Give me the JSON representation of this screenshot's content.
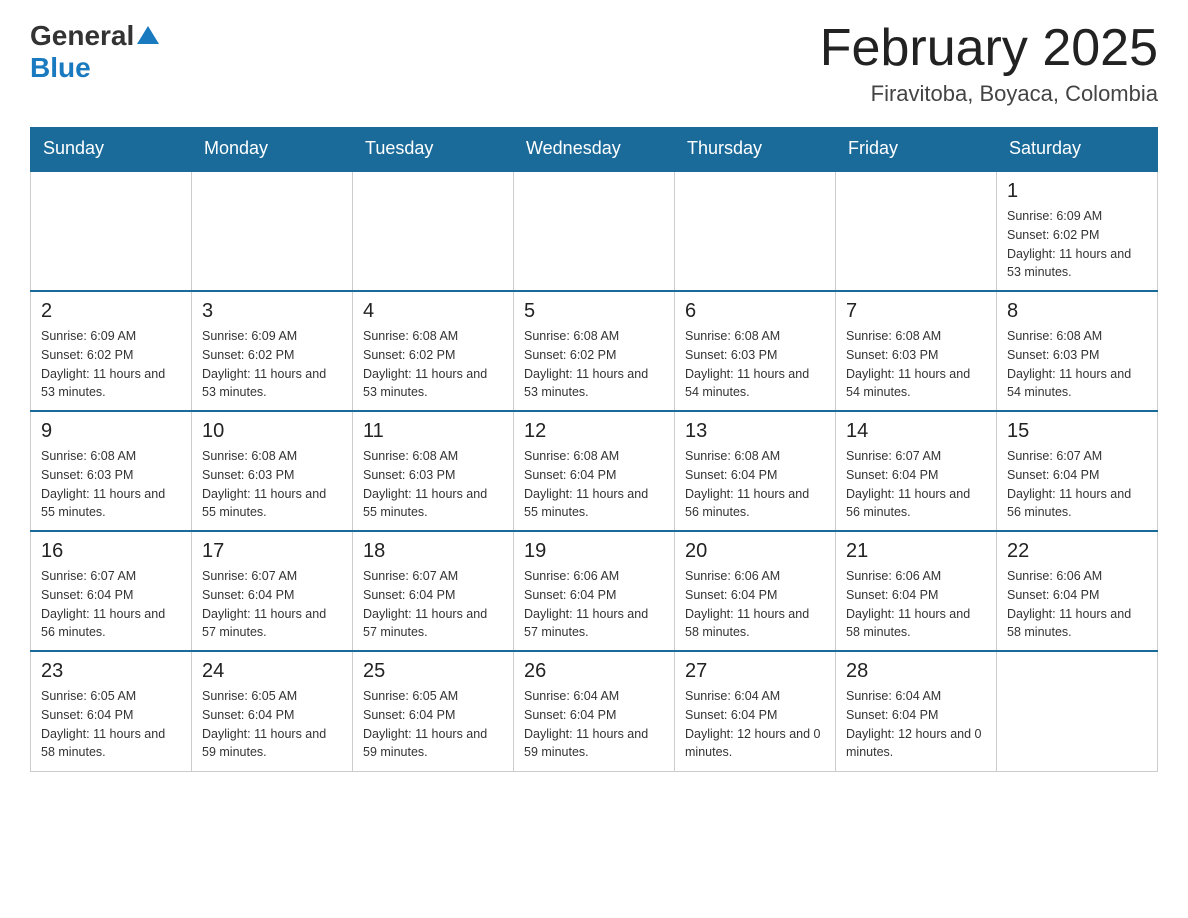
{
  "logo": {
    "general": "General",
    "blue": "Blue"
  },
  "title": "February 2025",
  "subtitle": "Firavitoba, Boyaca, Colombia",
  "days_of_week": [
    "Sunday",
    "Monday",
    "Tuesday",
    "Wednesday",
    "Thursday",
    "Friday",
    "Saturday"
  ],
  "weeks": [
    [
      {
        "day": "",
        "sunrise": "",
        "sunset": "",
        "daylight": ""
      },
      {
        "day": "",
        "sunrise": "",
        "sunset": "",
        "daylight": ""
      },
      {
        "day": "",
        "sunrise": "",
        "sunset": "",
        "daylight": ""
      },
      {
        "day": "",
        "sunrise": "",
        "sunset": "",
        "daylight": ""
      },
      {
        "day": "",
        "sunrise": "",
        "sunset": "",
        "daylight": ""
      },
      {
        "day": "",
        "sunrise": "",
        "sunset": "",
        "daylight": ""
      },
      {
        "day": "1",
        "sunrise": "Sunrise: 6:09 AM",
        "sunset": "Sunset: 6:02 PM",
        "daylight": "Daylight: 11 hours and 53 minutes."
      }
    ],
    [
      {
        "day": "2",
        "sunrise": "Sunrise: 6:09 AM",
        "sunset": "Sunset: 6:02 PM",
        "daylight": "Daylight: 11 hours and 53 minutes."
      },
      {
        "day": "3",
        "sunrise": "Sunrise: 6:09 AM",
        "sunset": "Sunset: 6:02 PM",
        "daylight": "Daylight: 11 hours and 53 minutes."
      },
      {
        "day": "4",
        "sunrise": "Sunrise: 6:08 AM",
        "sunset": "Sunset: 6:02 PM",
        "daylight": "Daylight: 11 hours and 53 minutes."
      },
      {
        "day": "5",
        "sunrise": "Sunrise: 6:08 AM",
        "sunset": "Sunset: 6:02 PM",
        "daylight": "Daylight: 11 hours and 53 minutes."
      },
      {
        "day": "6",
        "sunrise": "Sunrise: 6:08 AM",
        "sunset": "Sunset: 6:03 PM",
        "daylight": "Daylight: 11 hours and 54 minutes."
      },
      {
        "day": "7",
        "sunrise": "Sunrise: 6:08 AM",
        "sunset": "Sunset: 6:03 PM",
        "daylight": "Daylight: 11 hours and 54 minutes."
      },
      {
        "day": "8",
        "sunrise": "Sunrise: 6:08 AM",
        "sunset": "Sunset: 6:03 PM",
        "daylight": "Daylight: 11 hours and 54 minutes."
      }
    ],
    [
      {
        "day": "9",
        "sunrise": "Sunrise: 6:08 AM",
        "sunset": "Sunset: 6:03 PM",
        "daylight": "Daylight: 11 hours and 55 minutes."
      },
      {
        "day": "10",
        "sunrise": "Sunrise: 6:08 AM",
        "sunset": "Sunset: 6:03 PM",
        "daylight": "Daylight: 11 hours and 55 minutes."
      },
      {
        "day": "11",
        "sunrise": "Sunrise: 6:08 AM",
        "sunset": "Sunset: 6:03 PM",
        "daylight": "Daylight: 11 hours and 55 minutes."
      },
      {
        "day": "12",
        "sunrise": "Sunrise: 6:08 AM",
        "sunset": "Sunset: 6:04 PM",
        "daylight": "Daylight: 11 hours and 55 minutes."
      },
      {
        "day": "13",
        "sunrise": "Sunrise: 6:08 AM",
        "sunset": "Sunset: 6:04 PM",
        "daylight": "Daylight: 11 hours and 56 minutes."
      },
      {
        "day": "14",
        "sunrise": "Sunrise: 6:07 AM",
        "sunset": "Sunset: 6:04 PM",
        "daylight": "Daylight: 11 hours and 56 minutes."
      },
      {
        "day": "15",
        "sunrise": "Sunrise: 6:07 AM",
        "sunset": "Sunset: 6:04 PM",
        "daylight": "Daylight: 11 hours and 56 minutes."
      }
    ],
    [
      {
        "day": "16",
        "sunrise": "Sunrise: 6:07 AM",
        "sunset": "Sunset: 6:04 PM",
        "daylight": "Daylight: 11 hours and 56 minutes."
      },
      {
        "day": "17",
        "sunrise": "Sunrise: 6:07 AM",
        "sunset": "Sunset: 6:04 PM",
        "daylight": "Daylight: 11 hours and 57 minutes."
      },
      {
        "day": "18",
        "sunrise": "Sunrise: 6:07 AM",
        "sunset": "Sunset: 6:04 PM",
        "daylight": "Daylight: 11 hours and 57 minutes."
      },
      {
        "day": "19",
        "sunrise": "Sunrise: 6:06 AM",
        "sunset": "Sunset: 6:04 PM",
        "daylight": "Daylight: 11 hours and 57 minutes."
      },
      {
        "day": "20",
        "sunrise": "Sunrise: 6:06 AM",
        "sunset": "Sunset: 6:04 PM",
        "daylight": "Daylight: 11 hours and 58 minutes."
      },
      {
        "day": "21",
        "sunrise": "Sunrise: 6:06 AM",
        "sunset": "Sunset: 6:04 PM",
        "daylight": "Daylight: 11 hours and 58 minutes."
      },
      {
        "day": "22",
        "sunrise": "Sunrise: 6:06 AM",
        "sunset": "Sunset: 6:04 PM",
        "daylight": "Daylight: 11 hours and 58 minutes."
      }
    ],
    [
      {
        "day": "23",
        "sunrise": "Sunrise: 6:05 AM",
        "sunset": "Sunset: 6:04 PM",
        "daylight": "Daylight: 11 hours and 58 minutes."
      },
      {
        "day": "24",
        "sunrise": "Sunrise: 6:05 AM",
        "sunset": "Sunset: 6:04 PM",
        "daylight": "Daylight: 11 hours and 59 minutes."
      },
      {
        "day": "25",
        "sunrise": "Sunrise: 6:05 AM",
        "sunset": "Sunset: 6:04 PM",
        "daylight": "Daylight: 11 hours and 59 minutes."
      },
      {
        "day": "26",
        "sunrise": "Sunrise: 6:04 AM",
        "sunset": "Sunset: 6:04 PM",
        "daylight": "Daylight: 11 hours and 59 minutes."
      },
      {
        "day": "27",
        "sunrise": "Sunrise: 6:04 AM",
        "sunset": "Sunset: 6:04 PM",
        "daylight": "Daylight: 12 hours and 0 minutes."
      },
      {
        "day": "28",
        "sunrise": "Sunrise: 6:04 AM",
        "sunset": "Sunset: 6:04 PM",
        "daylight": "Daylight: 12 hours and 0 minutes."
      },
      {
        "day": "",
        "sunrise": "",
        "sunset": "",
        "daylight": ""
      }
    ]
  ]
}
